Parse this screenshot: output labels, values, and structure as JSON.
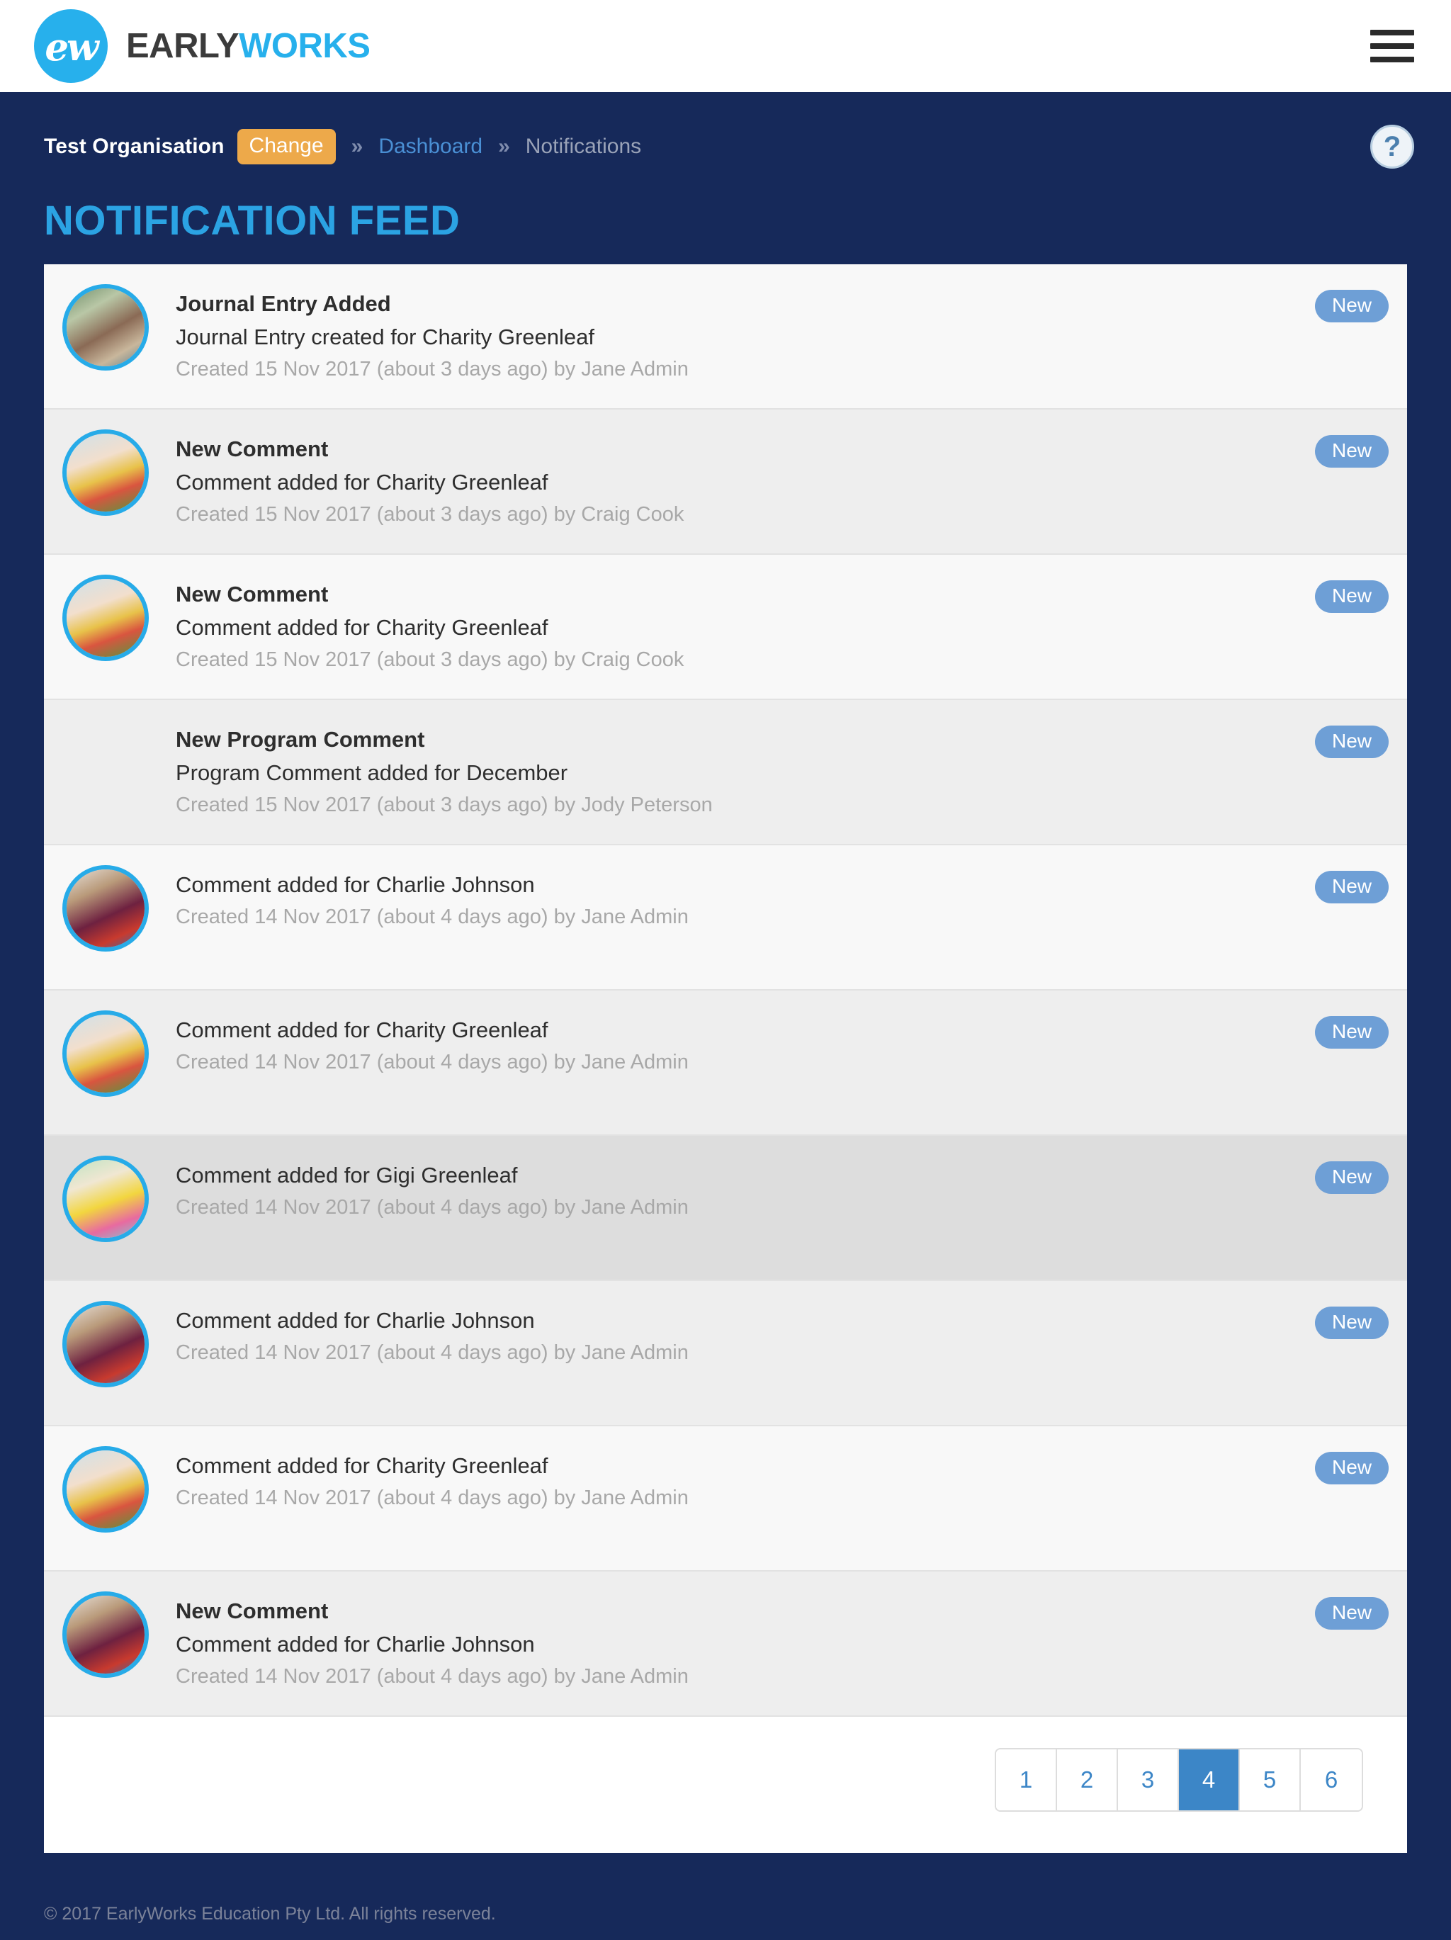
{
  "brand": {
    "mark_text": "ew",
    "name_first": "EARLY",
    "name_second": "WORKS"
  },
  "topbar": {
    "menu_label": "menu"
  },
  "breadcrumb": {
    "organisation": "Test Organisation",
    "change_label": "Change",
    "separator": "»",
    "dashboard_label": "Dashboard",
    "current_label": "Notifications",
    "help_label": "?"
  },
  "page": {
    "title": "NOTIFICATION FEED"
  },
  "colors": {
    "navy": "#16295a",
    "brand_blue": "#27b0ec",
    "title_blue": "#2ba3e3",
    "accent_orange": "#eda94a",
    "badge_blue": "#6e9fd6",
    "pager_active": "#3c86c7",
    "avatar_ring": "#27abe8"
  },
  "feed": {
    "badge_label": "New",
    "rows": [
      {
        "title": "Journal Entry Added",
        "text": "Journal Entry created for Charity Greenleaf",
        "meta": "Created 15 Nov 2017 (about 3 days ago) by Jane Admin",
        "badge": "New",
        "has_avatar": true,
        "avatar_name": "avatar-classroom-painting",
        "shade": "a"
      },
      {
        "title": "New Comment",
        "text": "Comment added for Charity Greenleaf",
        "meta": "Created 15 Nov 2017 (about 3 days ago) by Craig Cook",
        "badge": "New",
        "has_avatar": true,
        "avatar_name": "avatar-charity-greenleaf",
        "shade": "b"
      },
      {
        "title": "New Comment",
        "text": "Comment added for Charity Greenleaf",
        "meta": "Created 15 Nov 2017 (about 3 days ago) by Craig Cook",
        "badge": "New",
        "has_avatar": true,
        "avatar_name": "avatar-charity-greenleaf",
        "shade": "a"
      },
      {
        "title": "New Program Comment",
        "text": "Program Comment added for December",
        "meta": "Created 15 Nov 2017 (about 3 days ago) by Jody Peterson",
        "badge": "New",
        "has_avatar": false,
        "avatar_name": "",
        "shade": "b"
      },
      {
        "title": "",
        "text": "Comment added for Charlie Johnson",
        "meta": "Created 14 Nov 2017 (about 4 days ago) by Jane Admin",
        "badge": "New",
        "has_avatar": true,
        "avatar_name": "avatar-charlie-johnson",
        "shade": "a"
      },
      {
        "title": "",
        "text": "Comment added for Charity Greenleaf",
        "meta": "Created 14 Nov 2017 (about 4 days ago) by Jane Admin",
        "badge": "New",
        "has_avatar": true,
        "avatar_name": "avatar-charity-greenleaf",
        "shade": "b"
      },
      {
        "title": "",
        "text": "Comment added for Gigi Greenleaf",
        "meta": "Created 14 Nov 2017 (about 4 days ago) by Jane Admin",
        "badge": "New",
        "has_avatar": true,
        "avatar_name": "avatar-gigi-greenleaf",
        "shade": "hovered"
      },
      {
        "title": "",
        "text": "Comment added for Charlie Johnson",
        "meta": "Created 14 Nov 2017 (about 4 days ago) by Jane Admin",
        "badge": "New",
        "has_avatar": true,
        "avatar_name": "avatar-charlie-johnson",
        "shade": "b"
      },
      {
        "title": "",
        "text": "Comment added for Charity Greenleaf",
        "meta": "Created 14 Nov 2017 (about 4 days ago) by Jane Admin",
        "badge": "New",
        "has_avatar": true,
        "avatar_name": "avatar-charity-greenleaf",
        "shade": "a"
      },
      {
        "title": "New Comment",
        "text": "Comment added for Charlie Johnson",
        "meta": "Created 14 Nov 2017 (about 4 days ago) by Jane Admin",
        "badge": "New",
        "has_avatar": true,
        "avatar_name": "avatar-charlie-johnson",
        "shade": "b"
      }
    ]
  },
  "pagination": {
    "pages": [
      "1",
      "2",
      "3",
      "4",
      "5",
      "6"
    ],
    "active": "4"
  },
  "footer": {
    "copyright": "© 2017 EarlyWorks Education Pty Ltd. All rights reserved."
  }
}
